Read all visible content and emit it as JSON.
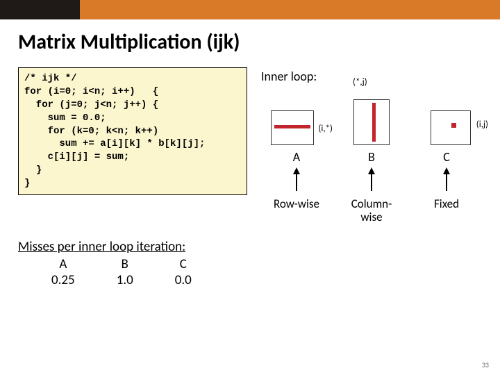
{
  "title": "Matrix Multiplication (ijk)",
  "code": "/* ijk */\nfor (i=0; i<n; i++)   {\n  for (j=0; j<n; j++) {\n    sum = 0.0;\n    for (k=0; k<n; k++)\n      sum += a[i][k] * b[k][j];\n    c[i][j] = sum;\n  }\n}",
  "inner_label": "Inner loop:",
  "matrices": {
    "a": {
      "name": "A",
      "annot": "(i,*)",
      "access": "Row-wise"
    },
    "b": {
      "name": "B",
      "annot": "(*,j)",
      "access": "Column-\nwise"
    },
    "c": {
      "name": "C",
      "annot": "(i,j)",
      "access": "Fixed"
    }
  },
  "misses": {
    "heading": "Misses per inner loop iteration:",
    "cols": [
      {
        "h": "A",
        "v": "0.25"
      },
      {
        "h": "B",
        "v": "1.0"
      },
      {
        "h": "C",
        "v": "0.0"
      }
    ]
  },
  "page_number": "33"
}
